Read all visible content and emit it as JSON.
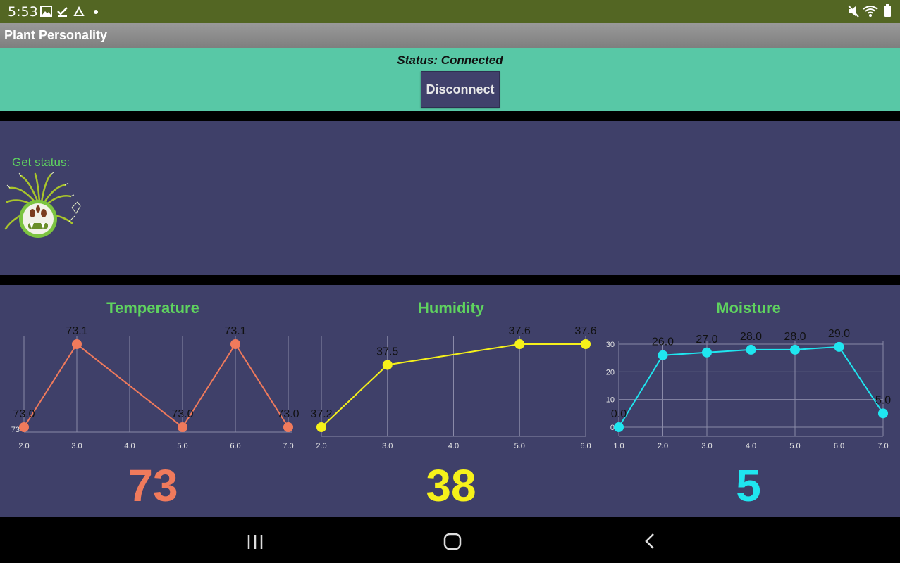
{
  "status_bar": {
    "time": "5:53",
    "left_icons": [
      "image-icon",
      "checkmark-icon",
      "drive-icon",
      "dot-icon"
    ],
    "right_icons": [
      "mute-icon",
      "wifi-icon",
      "battery-icon"
    ]
  },
  "app": {
    "title": "Plant Personality"
  },
  "connection": {
    "status_text": "Status: Connected",
    "button_label": "Disconnect"
  },
  "status_section": {
    "label": "Get status:",
    "image": "plant-character-icon"
  },
  "colors": {
    "status_bar": "#536623",
    "connection_panel": "#58c8a6",
    "panel_bg": "#3f4069",
    "title_green": "#5fd35f",
    "temperature": "#f07a5c",
    "humidity": "#f6f11a",
    "moisture": "#1fe6f0"
  },
  "chart_data": [
    {
      "type": "line",
      "title": "Temperature",
      "x": [
        2.0,
        3.0,
        5.0,
        6.0,
        7.0
      ],
      "values": [
        73.0,
        73.1,
        73.0,
        73.1,
        73.0
      ],
      "point_labels": [
        "73.0",
        "73.1",
        "73.0",
        "73.1",
        "73.0"
      ],
      "x_ticks": [
        "2.0",
        "3.0",
        "4.0",
        "5.0",
        "6.0",
        "7.0"
      ],
      "y_ticks": [
        "73"
      ],
      "xlim": [
        2,
        7
      ],
      "grid": true,
      "color": "#f07a5c",
      "current_value": "73"
    },
    {
      "type": "line",
      "title": "Humidity",
      "x": [
        2.0,
        3.0,
        5.0,
        6.0
      ],
      "values": [
        37.2,
        37.5,
        37.6,
        37.6
      ],
      "point_labels": [
        "37.2",
        "37.5",
        "37.6",
        "37.6"
      ],
      "x_ticks": [
        "2.0",
        "3.0",
        "4.0",
        "5.0",
        "6.0"
      ],
      "y_ticks": [],
      "xlim": [
        2,
        6
      ],
      "grid": true,
      "color": "#f6f11a",
      "current_value": "38"
    },
    {
      "type": "line",
      "title": "Moisture",
      "x": [
        1.0,
        2.0,
        3.0,
        4.0,
        5.0,
        6.0,
        7.0
      ],
      "values": [
        0.0,
        26.0,
        27.0,
        28.0,
        28.0,
        29.0,
        5.0
      ],
      "point_labels": [
        "0.0",
        "26.0",
        "27.0",
        "28.0",
        "28.0",
        "29.0",
        "5.0"
      ],
      "x_ticks": [
        "1.0",
        "2.0",
        "3.0",
        "4.0",
        "5.0",
        "6.0",
        "7.0"
      ],
      "y_ticks": [
        "0",
        "10",
        "20",
        "30"
      ],
      "xlim": [
        1,
        7
      ],
      "ylim": [
        0,
        30
      ],
      "grid": true,
      "color": "#1fe6f0",
      "current_value": "5"
    }
  ],
  "nav_bar": [
    "recents-icon",
    "home-icon",
    "back-icon"
  ]
}
